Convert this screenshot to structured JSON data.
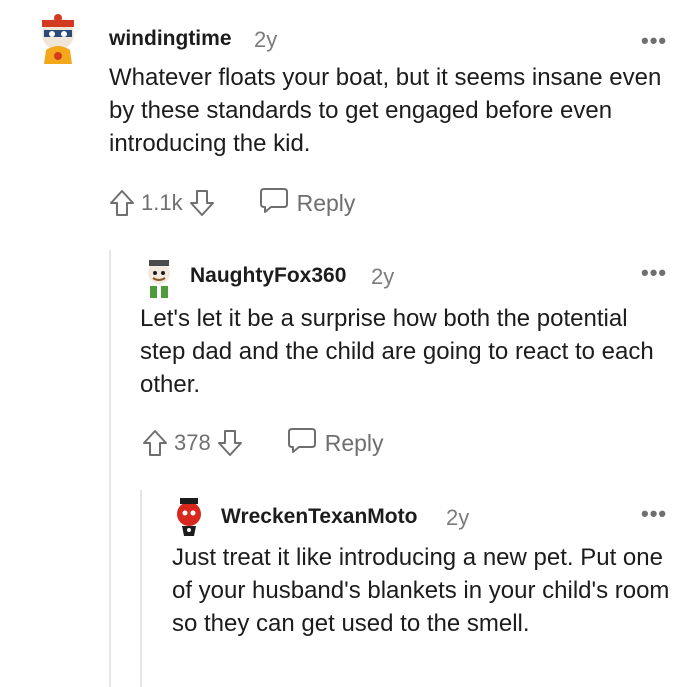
{
  "comments": [
    {
      "username": "windingtime",
      "age": "2y",
      "body": "Whatever floats your boat, but it seems insane even by these standards to get engaged before even introducing the kid.",
      "score": "1.1k",
      "reply_label": "Reply",
      "more_label": "•••"
    },
    {
      "username": "NaughtyFox360",
      "age": "2y",
      "body": "Let's let it be a surprise how both the potential step dad and the child are going to react to each other.",
      "score": "378",
      "reply_label": "Reply",
      "more_label": "•••"
    },
    {
      "username": "WreckenTexanMoto",
      "age": "2y",
      "body": "Just treat it like introducing a new pet. Put one of your husband's blankets in your child's room so they can get used to the smell.",
      "more_label": "•••"
    }
  ],
  "icons": {
    "upvote": "upvote-arrow-icon",
    "downvote": "downvote-arrow-icon",
    "reply": "speech-bubble-icon",
    "more": "more-options-icon"
  },
  "colors": {
    "text": "#1c1c1c",
    "muted": "#7c7c7c",
    "thread_line": "#e5e5e5"
  }
}
